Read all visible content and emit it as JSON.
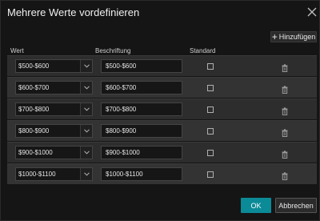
{
  "dialog": {
    "title": "Mehrere Werte vordefinieren",
    "close_icon": "close-icon"
  },
  "toolbar": {
    "add_label": "Hinzufügen",
    "add_icon": "plus-icon"
  },
  "columns": {
    "value": "Wert",
    "label": "Beschriftung",
    "default": "Standard"
  },
  "rows": [
    {
      "value": "$500-$600",
      "label": "$500-$600",
      "default": false
    },
    {
      "value": "$600-$700",
      "label": "$600-$700",
      "default": false
    },
    {
      "value": "$700-$800",
      "label": "$700-$800",
      "default": false
    },
    {
      "value": "$800-$900",
      "label": "$800-$900",
      "default": false
    },
    {
      "value": "$900-$1000",
      "label": "$900-$1000",
      "default": false
    },
    {
      "value": "$1000-$1100",
      "label": "$1000-$1100",
      "default": false
    }
  ],
  "footer": {
    "ok_label": "OK",
    "cancel_label": "Abbrechen"
  },
  "colors": {
    "primary": "#0b8a97",
    "background": "#151515",
    "row": "#2d2d2d"
  }
}
